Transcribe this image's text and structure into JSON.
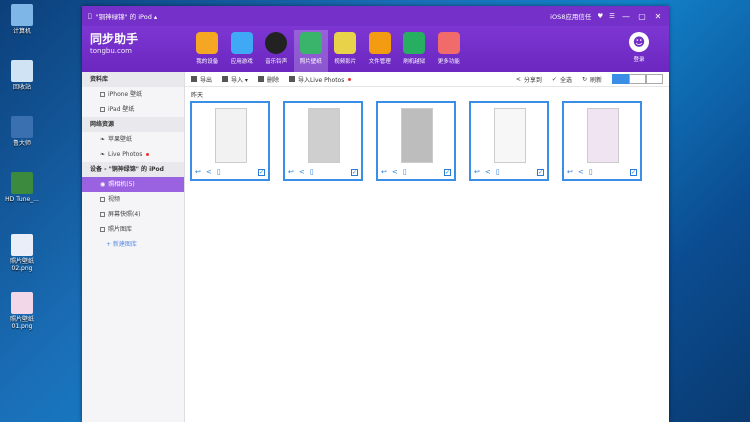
{
  "desktop": {
    "icons": [
      {
        "label": "计算机",
        "color": "#7fb6e8"
      },
      {
        "label": "回收站",
        "color": "#cfe3f4"
      },
      {
        "label": "鲁大师",
        "color": "#3a6fb0"
      },
      {
        "label": "HD Tune_...",
        "color": "#3b8a3e"
      },
      {
        "label": "照片壁纸 02.png",
        "color": "#e9eef8"
      },
      {
        "label": "照片壁纸 01.png",
        "color": "#f1d7e8"
      }
    ]
  },
  "window": {
    "title": "\"铜神绿锦\" 的 iPod ▴",
    "right_items": [
      "iOS8应用信任",
      "♥",
      "☰"
    ],
    "controls": [
      "—",
      "▢",
      "✕"
    ],
    "logo": {
      "name": "同步助手",
      "url": "tongbu.com"
    },
    "nav": [
      {
        "label": "我的设备",
        "color": "#f5a623"
      },
      {
        "label": "应用游戏",
        "color": "#3fa9f5"
      },
      {
        "label": "音乐铃声",
        "color": "#222222"
      },
      {
        "label": "照片壁纸",
        "color": "#3ab36b"
      },
      {
        "label": "视频影片",
        "color": "#e8d24a"
      },
      {
        "label": "文件管理",
        "color": "#f39c12"
      },
      {
        "label": "刷机越狱",
        "color": "#27ae60"
      },
      {
        "label": "更多功能",
        "color": "#f26b6b"
      }
    ],
    "nav_active_index": 3,
    "login_label": "登录"
  },
  "sidebar": {
    "section1": "资料库",
    "section1_items": [
      "iPhone 壁纸",
      "iPad 壁纸"
    ],
    "section2": "网络资源",
    "section2_items": [
      "苹果壁纸",
      "Live Photos"
    ],
    "section3": "设备 - \"铜神绿锦\" 的 iPod",
    "section3_items": [
      "照相机(5)",
      "视频",
      "屏幕快照(4)",
      "照片图库"
    ],
    "add_label": "+ 新建图库"
  },
  "content": {
    "toolbar": {
      "export": "导出",
      "import": "导入 ▾",
      "delete": "删除",
      "import_live": "导入Live Photos",
      "share": "分享到",
      "select_all": "全选",
      "refresh": "刷新"
    },
    "date_label": "昨天",
    "thumbs": [
      {
        "bg": "#f2f2f2"
      },
      {
        "bg": "#cfcfcf"
      },
      {
        "bg": "#bdbdbd"
      },
      {
        "bg": "#f7f7f7"
      },
      {
        "bg": "#f0e4f2"
      }
    ]
  }
}
